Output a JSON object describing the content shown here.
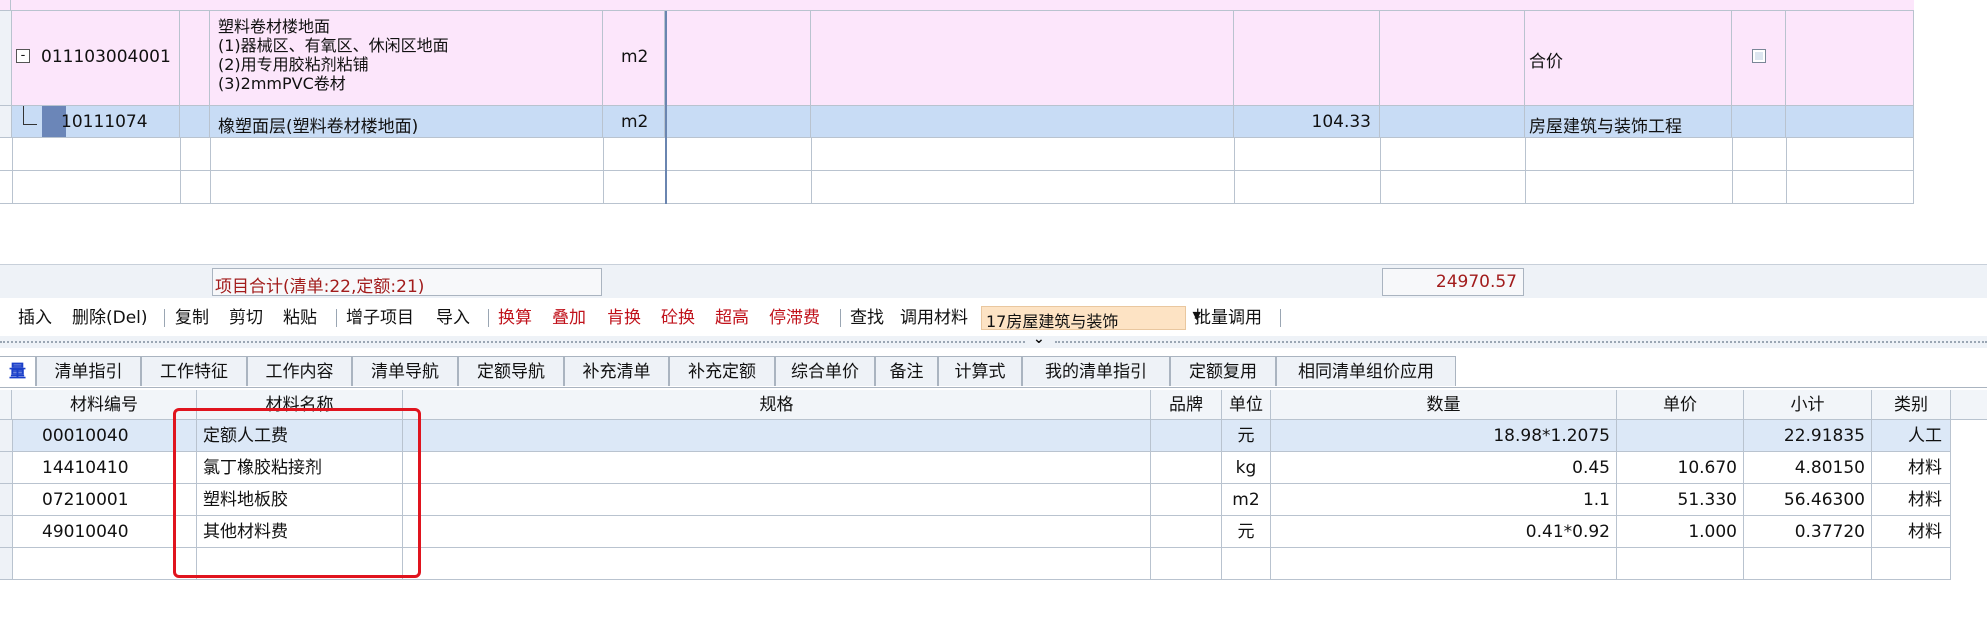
{
  "upper_grid": {
    "row1": {
      "tree_toggle": "-",
      "code": "011103004001",
      "name_lines": [
        "塑料卷材楼地面",
        "(1)器械区、有氧区、休闲区地面",
        "(2)用专用胶粘剂粘铺",
        "(3)2mmPVC卷材"
      ],
      "unit": "m2",
      "fee_type": "合价"
    },
    "row2": {
      "code": "10111074",
      "name": "橡塑面层(塑料卷材楼地面)",
      "unit": "m2",
      "value": "104.33",
      "specialty": "房屋建筑与装饰工程"
    }
  },
  "summary": {
    "label": "项目合计(清单:22,定额:21)",
    "total": "24970.57"
  },
  "toolbar": {
    "insert": "插入",
    "delete": "删除(Del)",
    "copy": "复制",
    "cut": "剪切",
    "paste": "粘贴",
    "add_sub": "增子项目",
    "import": "导入",
    "convert": "换算",
    "overlay": "叠加",
    "replace_fat": "肯换",
    "concrete_swap": "砼换",
    "super_high": "超高",
    "stop_fee": "停滞费",
    "find": "查找",
    "call_material": "调用材料",
    "library_select": "17房屋建筑与装饰",
    "batch_call": "批量调用",
    "splitter_arrow": "⌄"
  },
  "tabs": [
    "量",
    "清单指引",
    "工作特征",
    "工作内容",
    "清单导航",
    "定额导航",
    "补充清单",
    "补充定额",
    "综合单价",
    "备注",
    "计算式",
    "我的清单指引",
    "定额复用",
    "相同清单组价应用"
  ],
  "materials": {
    "headers": [
      "材料编号",
      "材料名称",
      "规格",
      "品牌",
      "单位",
      "数量",
      "单价",
      "小计",
      "类别"
    ],
    "rows": [
      {
        "code": "00010040",
        "name": "定额人工费",
        "spec": "",
        "brand": "",
        "unit": "元",
        "qty": "18.98*1.2075",
        "price": "",
        "subtotal": "22.91835",
        "category": "人工"
      },
      {
        "code": "14410410",
        "name": "氯丁橡胶粘接剂",
        "spec": "",
        "brand": "",
        "unit": "kg",
        "qty": "0.45",
        "price": "10.670",
        "subtotal": "4.80150",
        "category": "材料"
      },
      {
        "code": "07210001",
        "name": "塑料地板胶",
        "spec": "",
        "brand": "",
        "unit": "m2",
        "qty": "1.1",
        "price": "51.330",
        "subtotal": "56.46300",
        "category": "材料"
      },
      {
        "code": "49010040",
        "name": "其他材料费",
        "spec": "",
        "brand": "",
        "unit": "元",
        "qty": "0.41*0.92",
        "price": "1.000",
        "subtotal": "0.37720",
        "category": "材料"
      }
    ]
  },
  "colors": {
    "highlight_box": "#e0141e",
    "pink_row": "#fce6fb",
    "selected_row": "#c8dcf5",
    "red_toolbar_text": "#c0121b"
  }
}
